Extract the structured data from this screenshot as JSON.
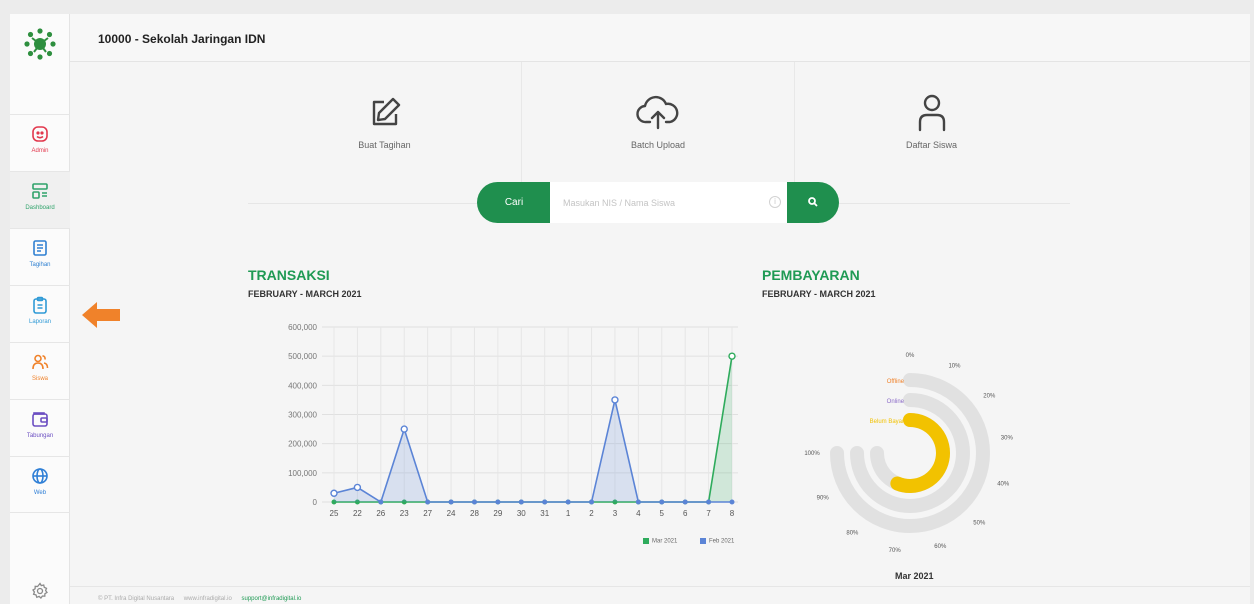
{
  "header": {
    "school": "10000 - Sekolah Jaringan IDN"
  },
  "sidebar": {
    "items": [
      {
        "label": "Admin",
        "icon": "face-icon",
        "color": "#e2384d"
      },
      {
        "label": "Dashboard",
        "icon": "dashboard-icon",
        "color": "#2fa26a"
      },
      {
        "label": "Tagihan",
        "icon": "invoice-icon",
        "color": "#2f80d1"
      },
      {
        "label": "Laporan",
        "icon": "clipboard-icon",
        "color": "#2f9ad6"
      },
      {
        "label": "Siswa",
        "icon": "users-icon",
        "color": "#f0822a"
      },
      {
        "label": "Tabungan",
        "icon": "wallet-icon",
        "color": "#6c4fc2"
      },
      {
        "label": "Web",
        "icon": "globe-icon",
        "color": "#2f7fd6"
      }
    ],
    "active": "Dashboard",
    "settings_icon": "gear-icon"
  },
  "actions": [
    {
      "label": "Buat Tagihan",
      "icon": "edit-icon"
    },
    {
      "label": "Batch Upload",
      "icon": "upload-cloud-icon"
    },
    {
      "label": "Daftar Siswa",
      "icon": "user-icon"
    }
  ],
  "search": {
    "button_label": "Cari",
    "placeholder": "Masukan NIS / Nama Siswa",
    "submit_icon": "search-icon"
  },
  "transaksi": {
    "title": "TRANSAKSI",
    "subtitle": "FEBRUARY - MARCH 2021"
  },
  "pembayaran": {
    "title": "PEMBAYARAN",
    "subtitle": "FEBRUARY - MARCH 2021",
    "caption": "Mar 2021"
  },
  "chart_data": [
    {
      "type": "area",
      "ylim": [
        0,
        600000
      ],
      "yticks": [
        "0",
        "100,000",
        "200,000",
        "300,000",
        "400,000",
        "500,000",
        "600,000"
      ],
      "categories": [
        "25",
        "22",
        "26",
        "23",
        "27",
        "24",
        "28",
        "29",
        "30",
        "31",
        "1",
        "2",
        "3",
        "4",
        "5",
        "6",
        "7",
        "8"
      ],
      "series": [
        {
          "name": "Mar 2021",
          "color": "#2eab5c",
          "values": [
            0,
            0,
            0,
            0,
            0,
            0,
            0,
            0,
            0,
            0,
            0,
            0,
            0,
            0,
            0,
            0,
            0,
            500000
          ]
        },
        {
          "name": "Feb 2021",
          "color": "#5b84d6",
          "values": [
            30000,
            50000,
            0,
            250000,
            0,
            0,
            0,
            0,
            0,
            0,
            0,
            0,
            350000,
            0,
            0,
            0,
            0,
            0
          ]
        }
      ],
      "grid": true,
      "legend_position": "bottom-right"
    },
    {
      "type": "radial-bar",
      "ticks": [
        "0%",
        "10%",
        "20%",
        "30%",
        "40%",
        "50%",
        "60%",
        "70%",
        "80%",
        "90%",
        "100%"
      ],
      "series": [
        {
          "name": "Offline",
          "value": 0,
          "color": "#f0822a"
        },
        {
          "name": "Online",
          "value": 0,
          "color": "#8c6cc8"
        },
        {
          "name": "Belum Bayar",
          "value": 75,
          "color": "#f2c200"
        }
      ],
      "track_color": "#e1e1e1"
    }
  ],
  "footer": {
    "company": "© PT. Infra Digital Nusantara",
    "website": "www.infradigital.io",
    "email": "support@infradigital.io"
  }
}
